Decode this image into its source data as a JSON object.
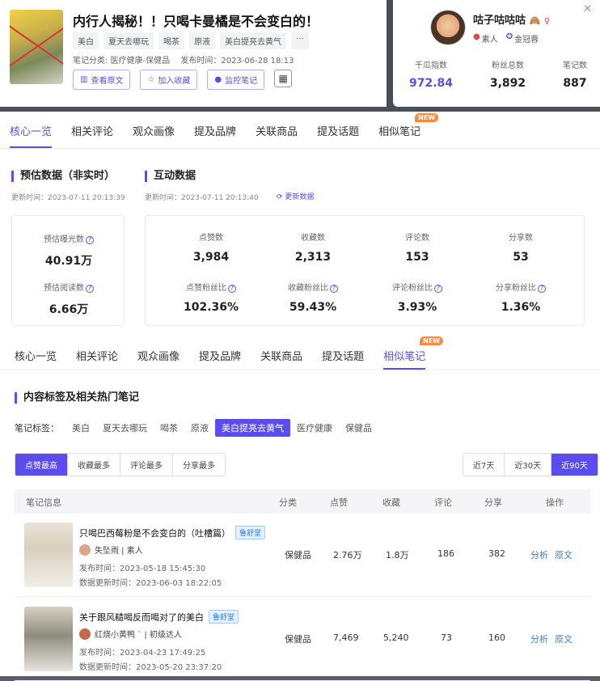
{
  "note": {
    "title": "内行人揭秘！！只喝卡曼橘是不会变白的！",
    "tags": [
      "美白",
      "夏天去哪玩",
      "喝茶",
      "原液",
      "美白提亮去黄气",
      "···"
    ],
    "category": "笔记分类: 医疗健康-保健品",
    "publish": "发布时间：2023-06-28 18:13",
    "actions": {
      "view": "查看原文",
      "collect": "加入收藏",
      "monitor": "监控笔记"
    }
  },
  "author": {
    "name": "咕子咕咕咕",
    "tag1": "素人",
    "tag2": "金冠蓉",
    "stats": [
      {
        "label": "千瓜指数",
        "value": "972.84"
      },
      {
        "label": "粉丝总数",
        "value": "3,892"
      },
      {
        "label": "笔记数",
        "value": "887"
      }
    ]
  },
  "tabs": [
    "核心一览",
    "相关评论",
    "观众画像",
    "提及品牌",
    "关联商品",
    "提及话题",
    "相似笔记"
  ],
  "new_badge": "NEW",
  "estimate": {
    "title": "预估数据（非实时）",
    "updated": "更新时间：2023-07-11 20:13:39",
    "exposure_label": "预估曝光数",
    "exposure": "40.91万",
    "read_label": "预估阅读数",
    "read": "6.66万"
  },
  "interaction": {
    "title": "互动数据",
    "updated": "更新时间：2023-07-11 20:13:40",
    "refresh": "更新数据",
    "metrics": [
      {
        "label": "点赞数",
        "value": "3,984"
      },
      {
        "label": "收藏数",
        "value": "2,313"
      },
      {
        "label": "评论数",
        "value": "153"
      },
      {
        "label": "分享数",
        "value": "53"
      },
      {
        "label": "点赞粉丝比",
        "value": "102.36%"
      },
      {
        "label": "收藏粉丝比",
        "value": "59.43%"
      },
      {
        "label": "评论粉丝比",
        "value": "3.93%"
      },
      {
        "label": "分享粉丝比",
        "value": "1.36%"
      }
    ]
  },
  "related": {
    "title": "内容标签及相关热门笔记",
    "filter_label": "笔记标签：",
    "filters": [
      "美白",
      "夏天去哪玩",
      "喝茶",
      "原液",
      "美白提亮去黄气",
      "医疗健康",
      "保健品"
    ],
    "sort": [
      "点赞最高",
      "收藏最多",
      "评论最多",
      "分享最多"
    ],
    "ranges": [
      "近7天",
      "近30天",
      "近90天"
    ],
    "headers": [
      "笔记信息",
      "分类",
      "点赞",
      "收藏",
      "评论",
      "分享",
      "操作"
    ],
    "rows": [
      {
        "title": "只喝巴西莓粉是不会变白的（吐槽篇）",
        "brand": "鲁舒堂",
        "author": "失坠雨 | 素人",
        "publish": "发布时间：2023-05-18 15:45:30",
        "updated": "数据更新时间：2023-06-03 18:22:05",
        "category": "保健品",
        "likes": "2.76万",
        "collects": "1.8万",
        "comments": "186",
        "shares": "382",
        "analyze": "分析",
        "origin": "原文"
      },
      {
        "title": "关于跟风糙喝反而喝对了的美白",
        "brand": "鲁舒堂",
        "author": "红烧小黄鸭 ` | 初级达人",
        "publish": "发布时间：2023-04-23 17:49:25",
        "updated": "数据更新时间：2023-05-20 23:37:20",
        "category": "保健品",
        "likes": "7,469",
        "collects": "5,240",
        "comments": "73",
        "shares": "160",
        "analyze": "分析",
        "origin": "原文"
      }
    ]
  }
}
